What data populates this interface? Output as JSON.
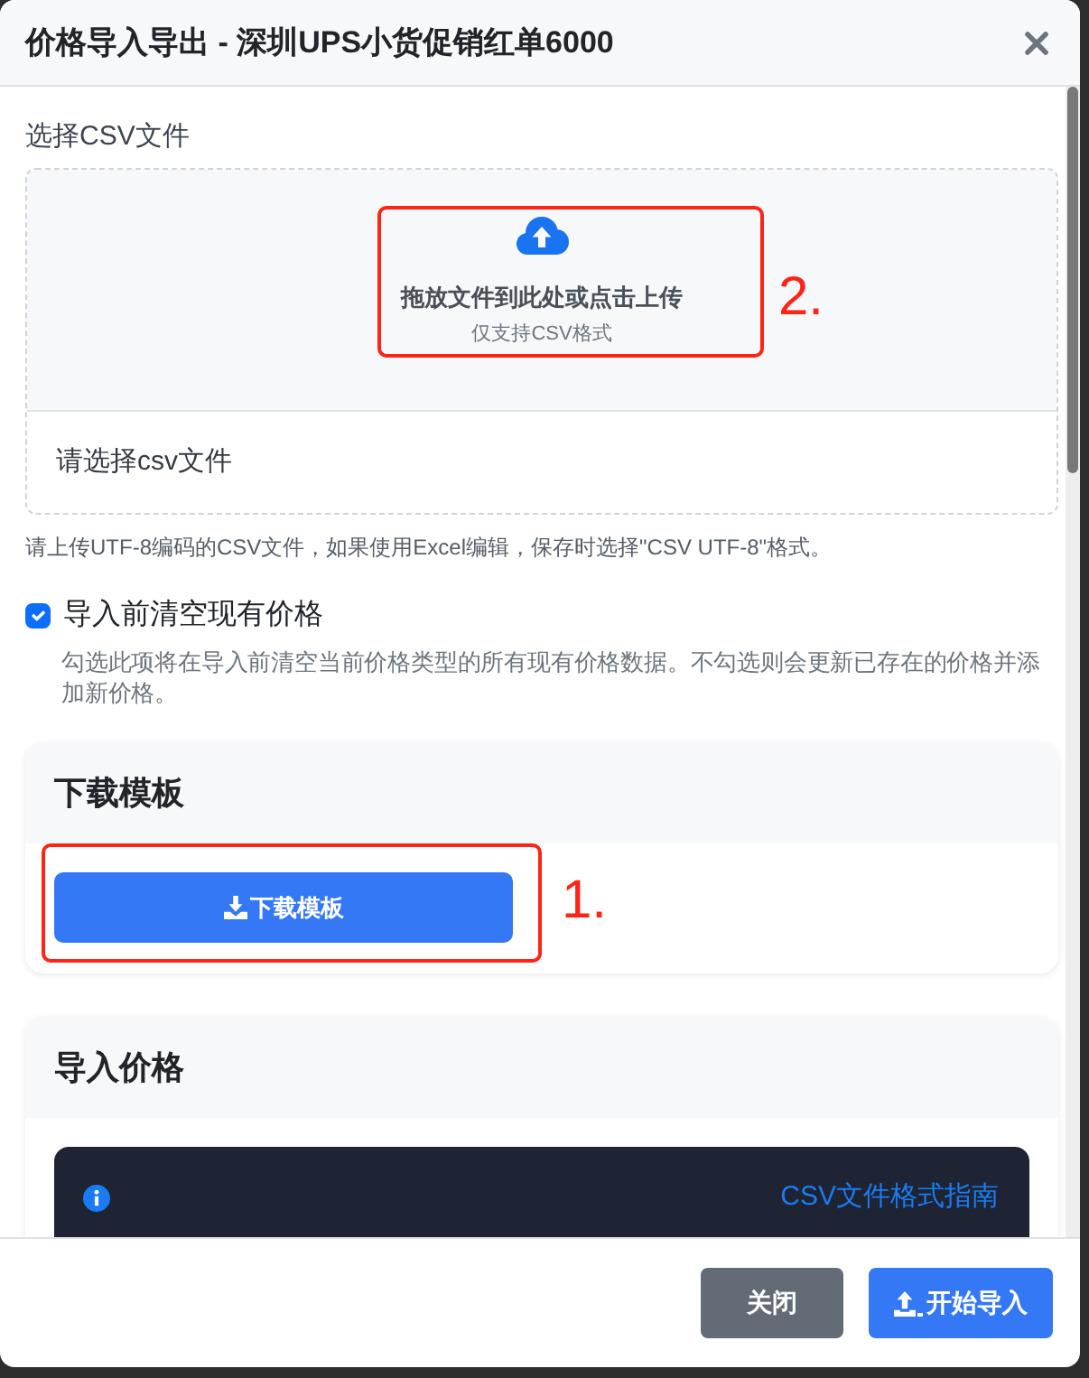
{
  "dialog": {
    "title": "价格导入导出 - 深圳UPS小货促销红单6000"
  },
  "file_input": {
    "label": "选择CSV文件",
    "drop_text": "拖放文件到此处或点击上传",
    "drop_hint": "仅支持CSV格式",
    "annotation": "2.",
    "file_list_text": "请选择csv文件"
  },
  "help_text": "请上传UTF-8编码的CSV文件，如果使用Excel编辑，保存时选择\"CSV UTF-8\"格式。",
  "clear_existing": {
    "label": "导入前清空现有价格",
    "checked": true,
    "description": "勾选此项将在导入前清空当前价格类型的所有现有价格数据。不勾选则会更新已存在的价格并添加新价格。"
  },
  "download_card": {
    "title": "下载模板",
    "button": "下载模板",
    "annotation": "1."
  },
  "import_card": {
    "title": "导入价格",
    "guide_link": "CSV文件格式指南"
  },
  "footer": {
    "buttons": [
      {
        "label": "关闭",
        "kind": "secondary"
      },
      {
        "label": "开始导入",
        "kind": "primary"
      }
    ]
  }
}
